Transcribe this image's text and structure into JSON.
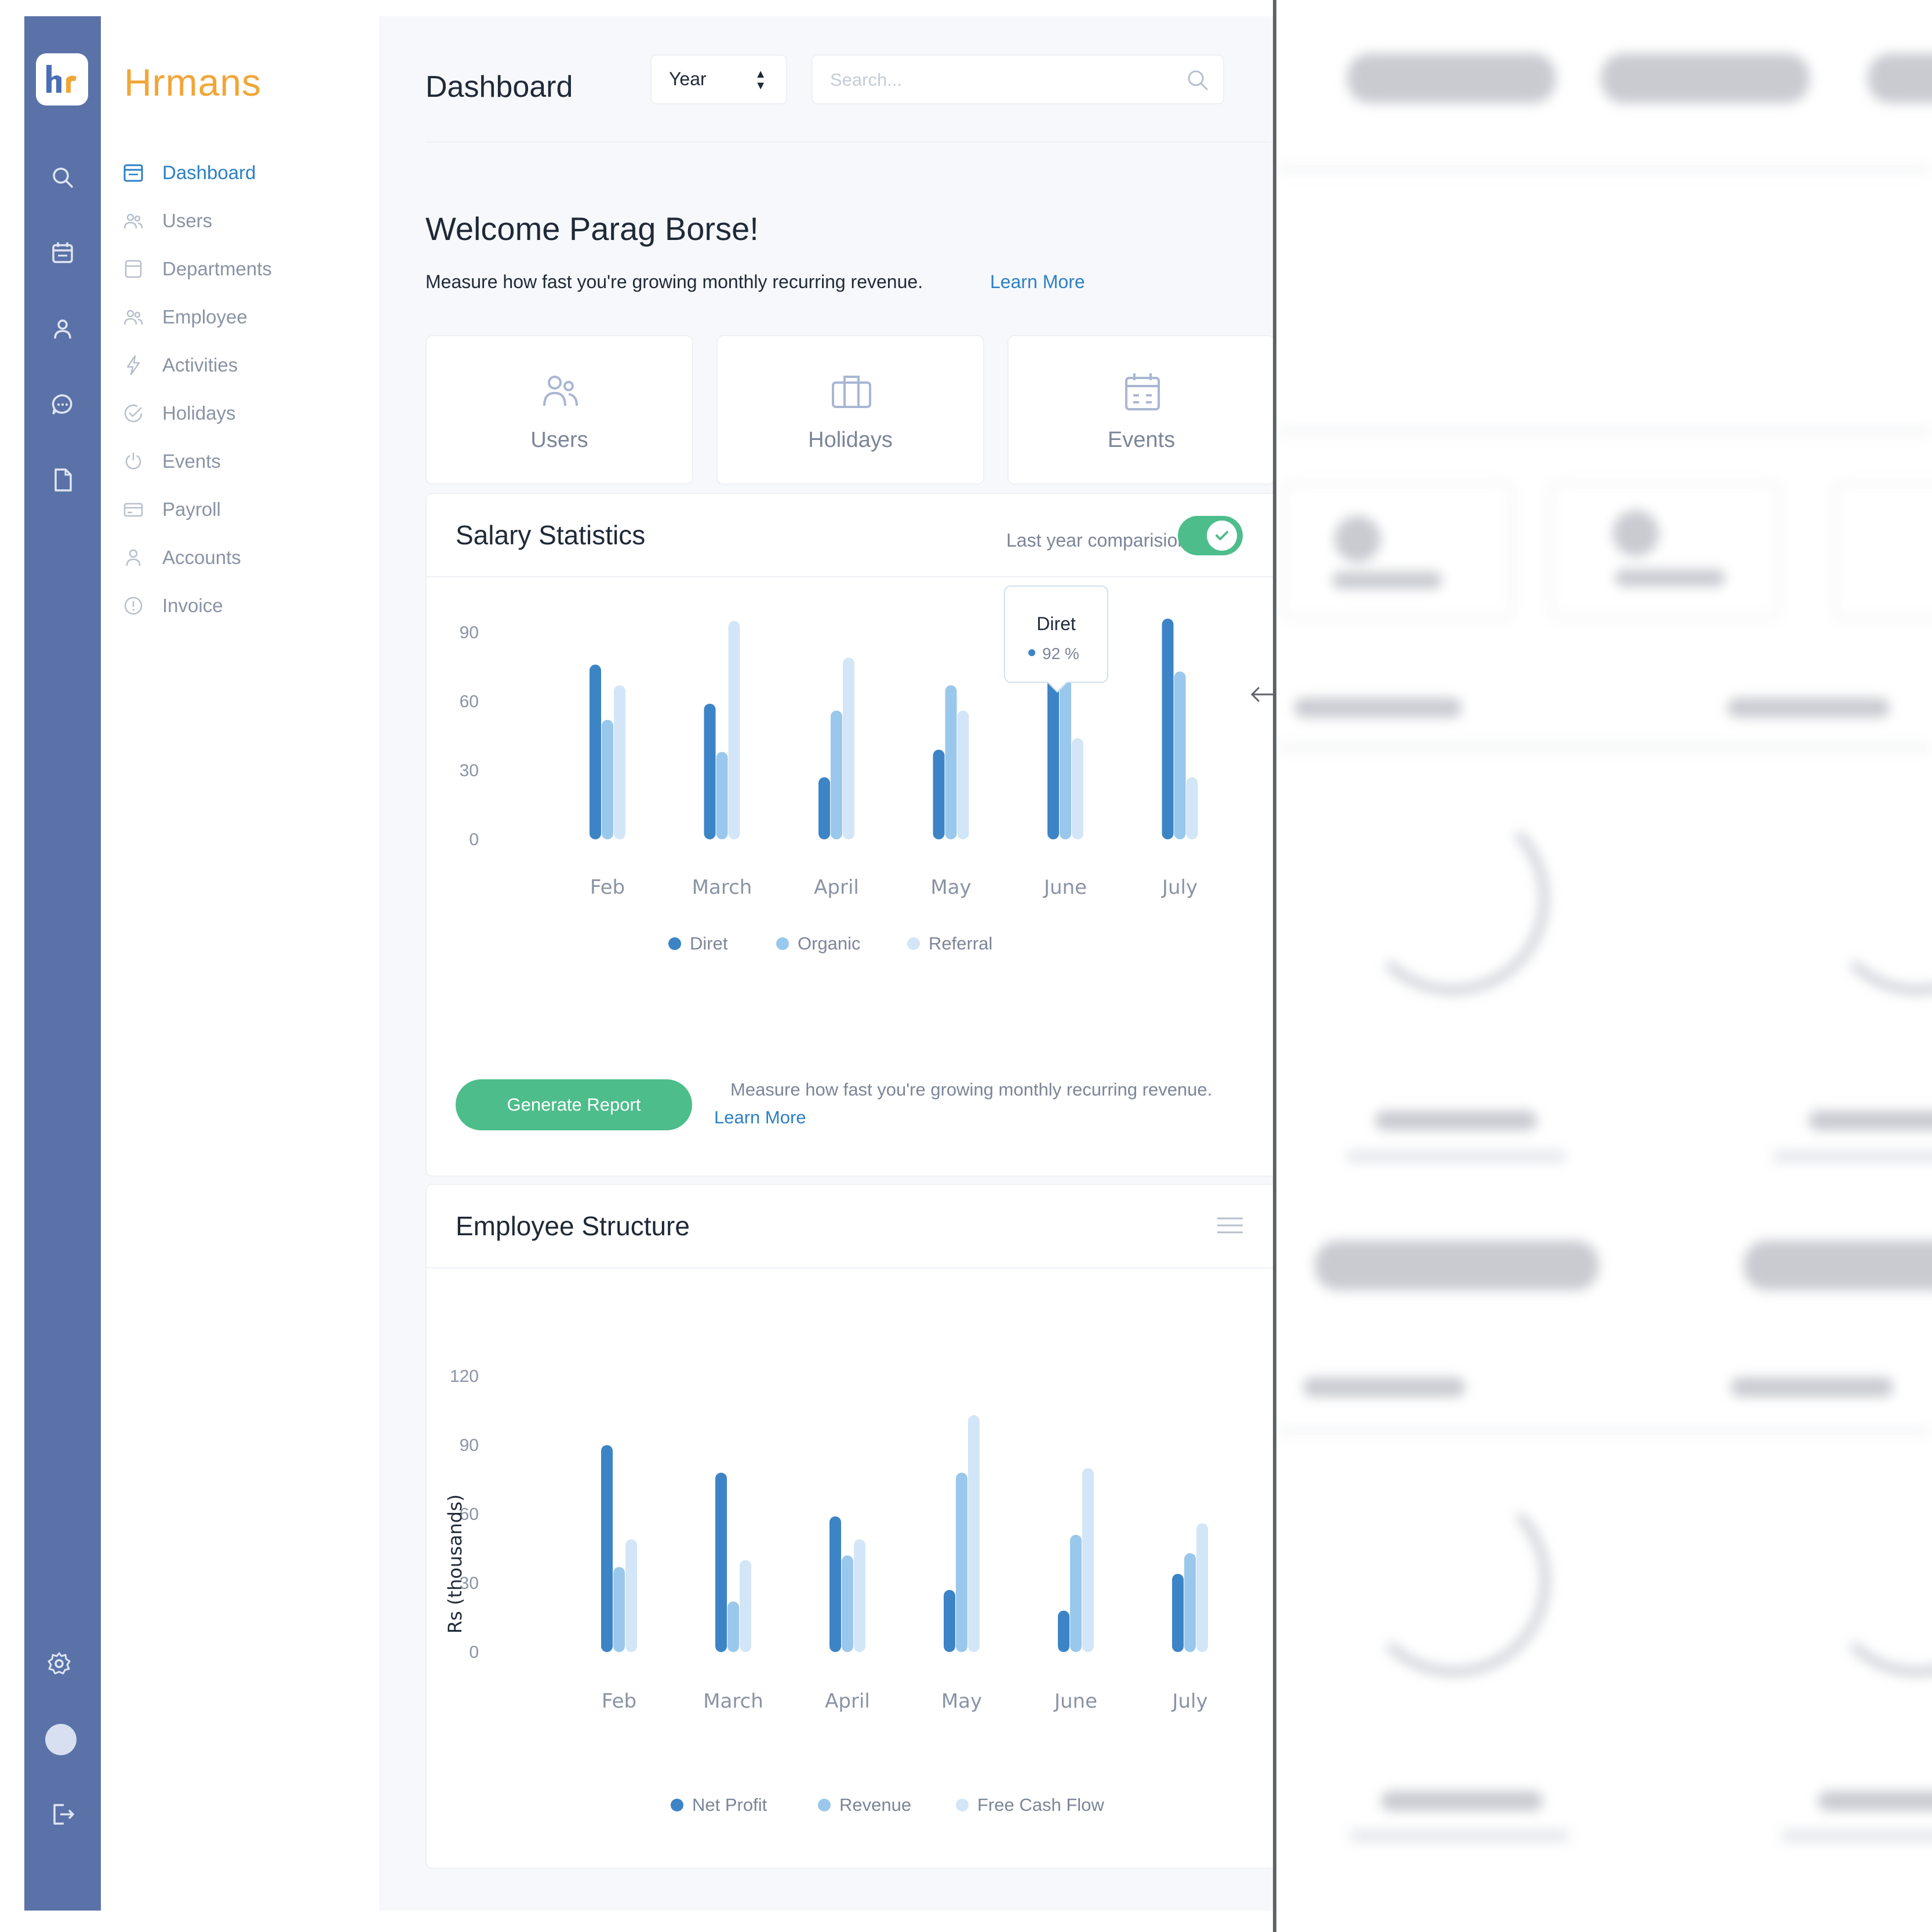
{
  "brand": {
    "name": "Hrmans",
    "logo_text": "hr"
  },
  "rail": {
    "icons": [
      "search-icon",
      "calendar-icon",
      "user-icon",
      "chat-icon",
      "document-icon"
    ],
    "bottom_icons": [
      "settings-icon",
      "avatar",
      "logout-icon"
    ]
  },
  "nav": {
    "items": [
      {
        "label": "Dashboard",
        "icon": "calendar-icon",
        "active": true
      },
      {
        "label": "Users",
        "icon": "users-icon"
      },
      {
        "label": "Departments",
        "icon": "database-icon"
      },
      {
        "label": "Employee",
        "icon": "users-icon"
      },
      {
        "label": "Activities",
        "icon": "bolt-icon"
      },
      {
        "label": "Holidays",
        "icon": "check-circle-icon"
      },
      {
        "label": "Events",
        "icon": "power-icon"
      },
      {
        "label": "Payroll",
        "icon": "card-icon"
      },
      {
        "label": "Accounts",
        "icon": "user-icon"
      },
      {
        "label": "Invoice",
        "icon": "info-icon"
      }
    ]
  },
  "header": {
    "title": "Dashboard",
    "select_value": "Year",
    "search_placeholder": "Search..."
  },
  "welcome": {
    "heading": "Welcome Parag Borse!",
    "text": "Measure how fast you're growing monthly recurring revenue.",
    "link": "Learn More"
  },
  "quick_cards": [
    {
      "label": "Users",
      "icon": "users-icon"
    },
    {
      "label": "Holidays",
      "icon": "briefcase-icon"
    },
    {
      "label": "Events",
      "icon": "calendar-icon"
    }
  ],
  "salary": {
    "title": "Salary Statistics",
    "comparison_label": "Last year comparision:",
    "comparison_on": true,
    "tooltip": {
      "title": "Diret",
      "value": "92 %"
    },
    "button": "Generate Report",
    "note": "Measure how fast you're growing monthly recurring revenue.",
    "link": "Learn More"
  },
  "employee": {
    "title": "Employee Structure",
    "ylabel": "Rs (thousands)"
  },
  "colors": {
    "series1": "#3d84c6",
    "series2": "#9ac8ec",
    "series3": "#d3e6f7",
    "accent_green": "#4dbd8b",
    "link": "#2c80c6",
    "rail": "#5a72a8"
  },
  "chart_data": [
    {
      "type": "bar",
      "title": "Salary Statistics",
      "categories": [
        "Feb",
        "March",
        "April",
        "May",
        "June",
        "July"
      ],
      "yticks": [
        0,
        30,
        60,
        90,
        120
      ],
      "ylim": [
        0,
        120
      ],
      "legend": "bottom",
      "series": [
        {
          "name": "Diret",
          "values": [
            76,
            59,
            27,
            39,
            91,
            96
          ]
        },
        {
          "name": "Organic",
          "values": [
            52,
            38,
            56,
            67,
            73,
            73
          ]
        },
        {
          "name": "Referral",
          "values": [
            67,
            95,
            79,
            56,
            44,
            27
          ]
        }
      ]
    },
    {
      "type": "bar",
      "title": "Employee Structure",
      "ylabel": "Rs (thousands)",
      "categories": [
        "Feb",
        "March",
        "April",
        "May",
        "June",
        "July"
      ],
      "yticks": [
        0,
        30,
        60,
        90,
        120
      ],
      "ylim": [
        0,
        120
      ],
      "legend": "bottom",
      "series": [
        {
          "name": "Net Profit",
          "values": [
            90,
            78,
            59,
            27,
            18,
            34
          ]
        },
        {
          "name": "Revenue",
          "values": [
            37,
            22,
            42,
            78,
            51,
            43
          ]
        },
        {
          "name": "Free Cash Flow",
          "values": [
            49,
            40,
            49,
            103,
            80,
            56
          ]
        }
      ]
    }
  ]
}
